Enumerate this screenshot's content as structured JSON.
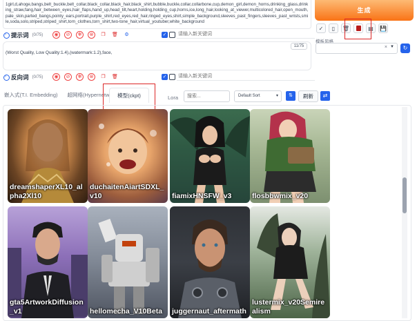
{
  "positive": {
    "text": "1girl,d,ahoge,bangs,belt_buckle,belt_collar,black_collar,black_hair,black_shirt,bubble,buckle,collar,collarbone,cup,demon_girl,demon_horns,drinking_glass,drinking_straw,fang,hair_between_eyes,hair_flaps,hand_up,head_tilt,heart,holding,holding_cup,horns,ice,long_hair,looking_at_viewer,multicolored_hair,open_mouth,pale_skin,parted_bangs,pointy_ears,portrait,purple_shirt,red_eyes,red_hair,ringed_eyes,shirt,simple_background,sleeves_past_fingers,sleeves_past_wrists,smile,soda,solo,striped,striped_shirt,torn_clothes,torn_shirt,two-tone_hair,virtual_youtuber,white_background",
    "label": "提示词",
    "count": "(0/75)",
    "input_placeholder": "请输入新关键词"
  },
  "negative": {
    "text": "(Worst Quality, Low Quality:1.4),(watermark:1.2),face,",
    "label": "反向词",
    "count": "(0/75)",
    "token_counter": "11/75",
    "input_placeholder": "请输入新关键词"
  },
  "generate_button": "生成",
  "style_label": "模板风格",
  "tabs": {
    "embedding": "嵌入式(T.I. Embedding)",
    "hypernetwork": "超网络(Hypernetwork)",
    "checkpoint": "模型(ckpt)",
    "lora": "Lora"
  },
  "search_placeholder": "搜索...",
  "sort_value": "Default Sort",
  "refresh_label": "刷新",
  "cards": [
    {
      "name": "dreamshaperXL10_alpha2Xl10"
    },
    {
      "name": "duchaitenAiartSDXL_v10"
    },
    {
      "name": "fiamixHNSFW_v3"
    },
    {
      "name": "flosbbwmix_v20"
    },
    {
      "name": "gta5ArtworkDiffusion_v1"
    },
    {
      "name": "hellomecha_V10Beta"
    },
    {
      "name": "juggernaut_aftermath"
    },
    {
      "name": "lustermix_v20Semirealism"
    }
  ],
  "colors": {
    "generate_bg": "#f97316",
    "accent_blue": "#2563eb",
    "highlight_red": "#dc2626"
  }
}
